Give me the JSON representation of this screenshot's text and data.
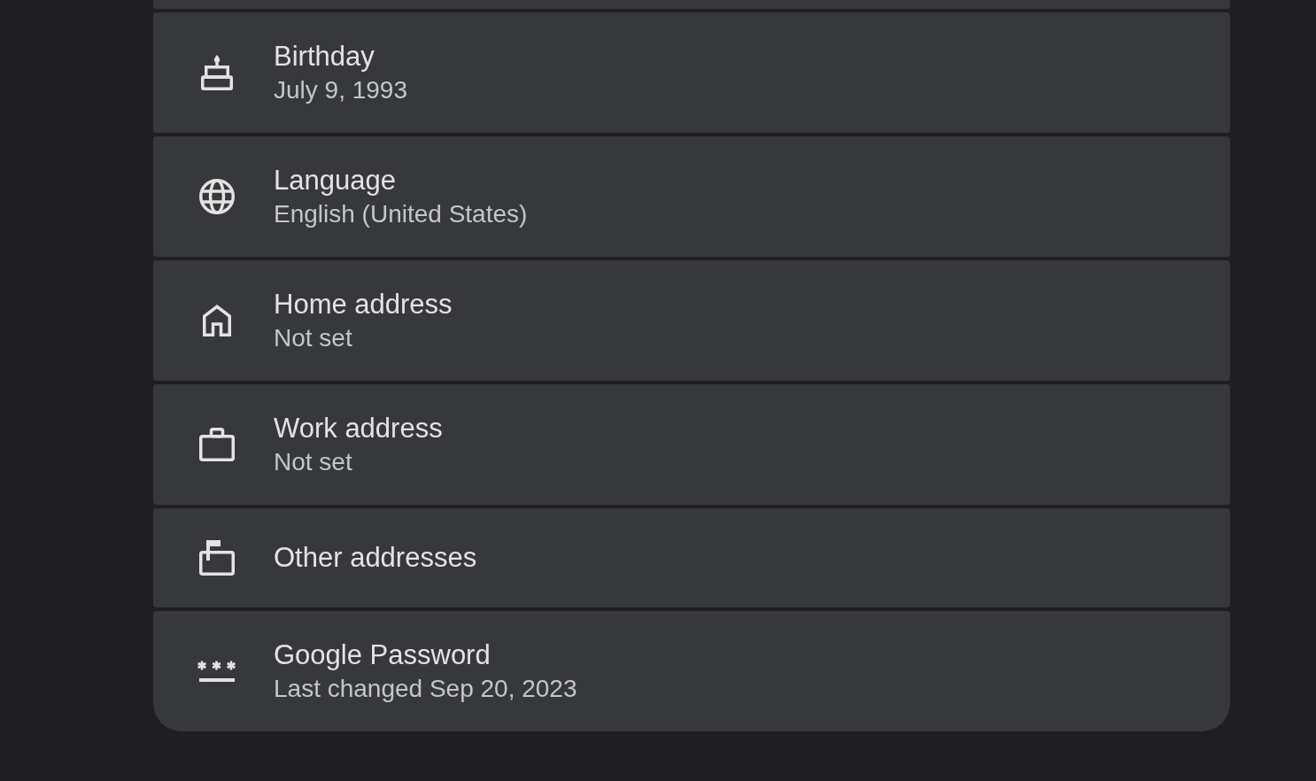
{
  "rows": [
    {
      "title": "Birthday",
      "value": "July 9, 1993"
    },
    {
      "title": "Language",
      "value": "English (United States)"
    },
    {
      "title": "Home address",
      "value": "Not set"
    },
    {
      "title": "Work address",
      "value": "Not set"
    },
    {
      "title": "Other addresses"
    },
    {
      "title": "Google Password",
      "value": "Last changed Sep 20, 2023"
    }
  ]
}
